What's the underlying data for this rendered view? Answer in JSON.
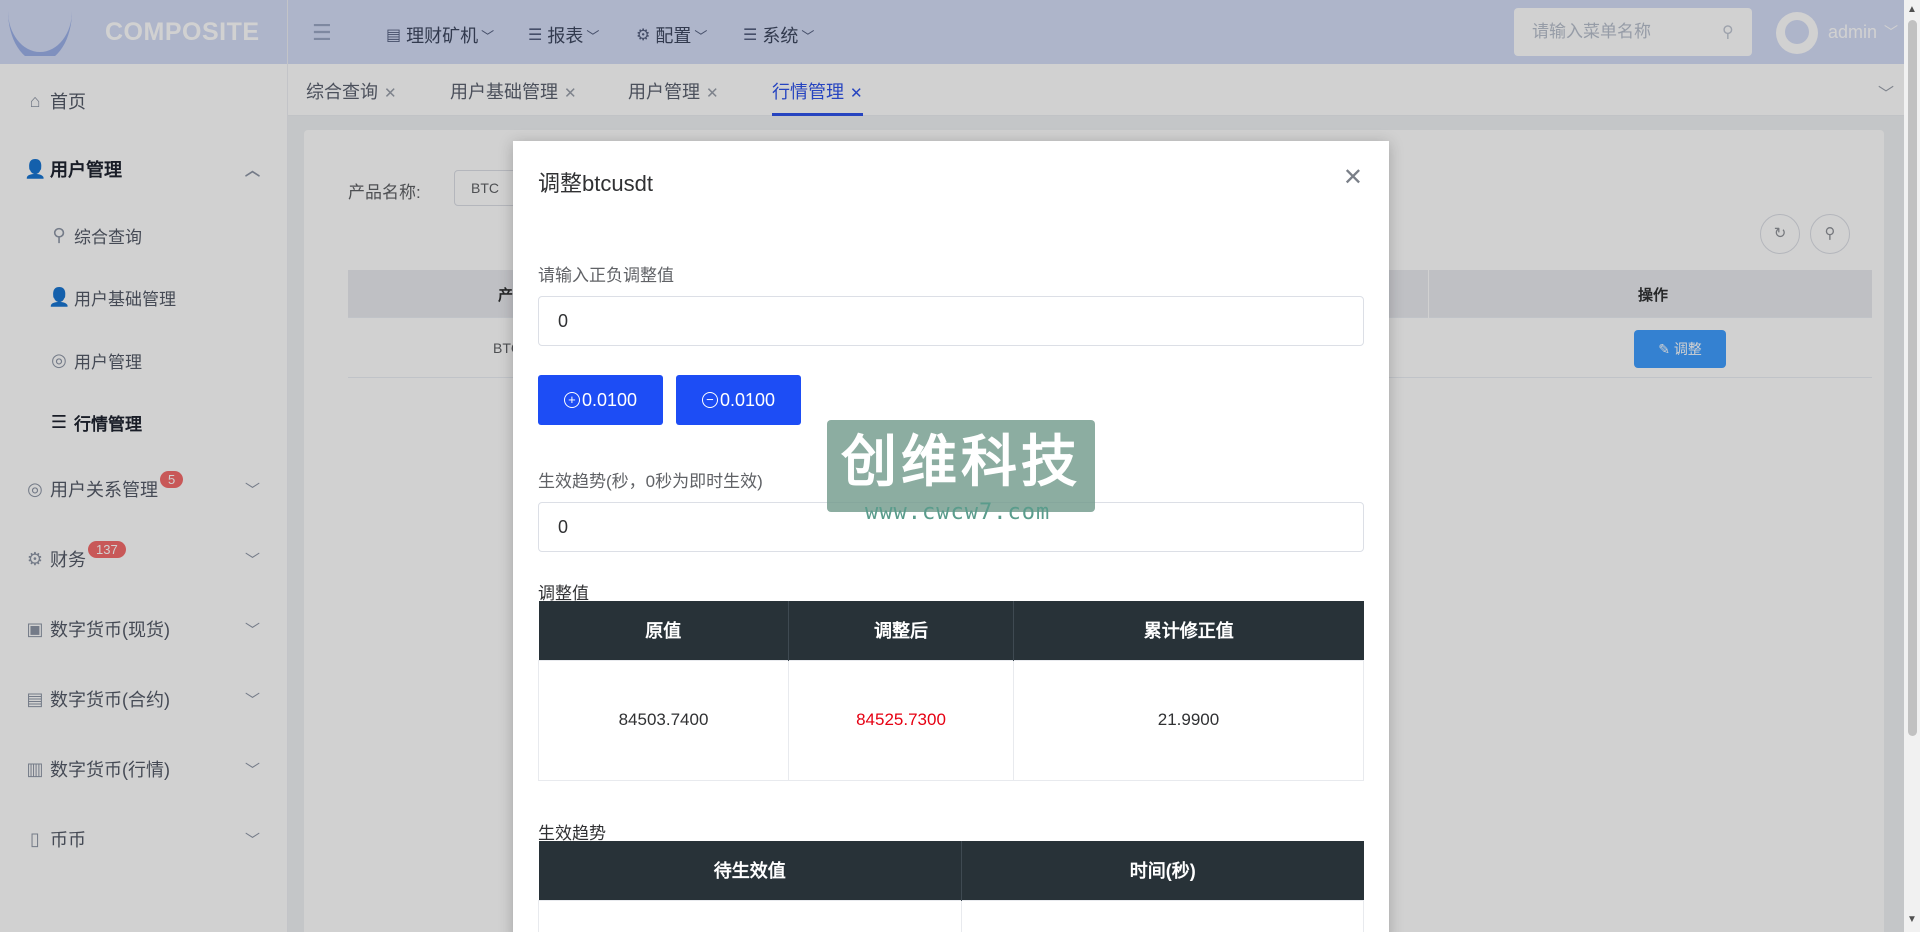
{
  "brand": {
    "logo_text": "COMPOSITE"
  },
  "sidebar": {
    "home": "首页",
    "user_mgmt": "用户管理",
    "sub": [
      "综合查询",
      "用户基础管理",
      "用户管理",
      "行情管理"
    ],
    "user_relation": "用户关系管理",
    "user_relation_badge": "5",
    "finance": "财务",
    "finance_badge": "137",
    "crypto_spot": "数字货币(现货)",
    "crypto_contract": "数字货币(合约)",
    "crypto_market": "数字货币(行情)",
    "coin": "币币"
  },
  "header": {
    "menus": [
      "理财矿机",
      "报表",
      "配置",
      "系统"
    ],
    "search_placeholder": "请输入菜单名称",
    "username": "admin"
  },
  "tabs": [
    "综合查询",
    "用户基础管理",
    "用户管理",
    "行情管理"
  ],
  "page": {
    "filter_label": "产品名称:",
    "filter_value": "BTC",
    "col_product": "产品",
    "col_op": "操作",
    "row_product": "BTC/",
    "row_adjust": "调整"
  },
  "dialog": {
    "title": "调整btcusdt",
    "adjust_label": "请输入正负调整值",
    "adjust_value": "0",
    "plus_label": "0.0100",
    "minus_label": "0.0100",
    "trend_label": "生效趋势(秒，0秒为即时生效)",
    "trend_value": "0",
    "adj_section": "调整值",
    "adj_headers": [
      "原值",
      "调整后",
      "累计修正值"
    ],
    "adj_values": [
      "84503.7400",
      "84525.7300",
      "21.9900"
    ],
    "trend_section": "生效趋势",
    "trend_headers": [
      "待生效值",
      "时间(秒)"
    ]
  },
  "watermark": {
    "text": "创维科技",
    "url": "www.cwcw7.com"
  },
  "colors": {
    "primary": "#1d4df5",
    "header_bg": "#d5ddf7",
    "table_head": "#283238",
    "highlight": "#e60012"
  }
}
